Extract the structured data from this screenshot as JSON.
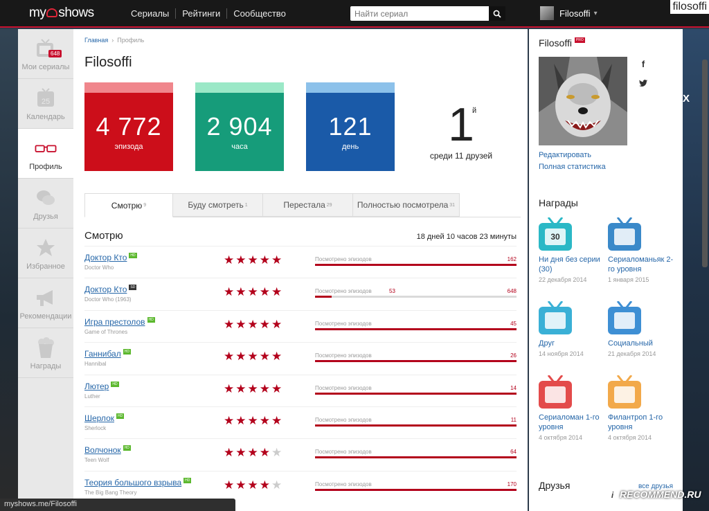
{
  "header": {
    "logo_prefix": "my",
    "logo_suffix": "shows",
    "nav": [
      "Сериалы",
      "Рейтинги",
      "Сообщество"
    ],
    "search_placeholder": "Найти сериал",
    "username": "Filosoffi",
    "watermark": "filosoffi"
  },
  "sidebar": {
    "items": [
      {
        "label": "Мои сериалы",
        "icon": "tv-icon",
        "badge": "648"
      },
      {
        "label": "Календарь",
        "icon": "calendar-icon",
        "day": "25"
      },
      {
        "label": "Профиль",
        "icon": "glasses-icon"
      },
      {
        "label": "Друзья",
        "icon": "chat-bubbles-icon"
      },
      {
        "label": "Избранное",
        "icon": "star-icon"
      },
      {
        "label": "Рекомендации",
        "icon": "megaphone-icon"
      },
      {
        "label": "Награды",
        "icon": "popcorn-icon"
      }
    ]
  },
  "breadcrumb": {
    "home": "Главная",
    "separator": "›",
    "current": "Профиль"
  },
  "profile": {
    "title": "Filosoffi",
    "stats": [
      {
        "value": "4 772",
        "label": "эпизода",
        "color": "#cc0e1a",
        "strip": "#f0868c"
      },
      {
        "value": "2 904",
        "label": "часа",
        "color": "#169c7a",
        "strip": "#9be8c7"
      },
      {
        "value": "121",
        "label": "день",
        "color": "#1a5aa8",
        "strip": "#8cc1ea"
      }
    ],
    "rank": {
      "number": "1",
      "suffix": "й",
      "caption": "среди 11 друзей"
    }
  },
  "tabs": [
    {
      "label": "Смотрю",
      "count": "9"
    },
    {
      "label": "Буду смотреть",
      "count": "1"
    },
    {
      "label": "Перестала",
      "count": "29"
    },
    {
      "label": "Полностью посмотрела",
      "count": "31"
    }
  ],
  "watching": {
    "heading": "Смотрю",
    "total_time": "18 дней 10 часов 23 минуты",
    "progress_label": "Посмотрено эпизодов",
    "hd_tag": "HD",
    "pro_tag": "PRO",
    "shows": [
      {
        "title": "Доктор Кто",
        "original": "Doctor Who",
        "rating": 5,
        "watched": "162",
        "progress": 1.0,
        "tag": "HD",
        "tag_dark": false
      },
      {
        "title": "Доктор Кто",
        "original": "Doctor Who (1963)",
        "rating": 5,
        "watched_mid": "53",
        "watched": "648",
        "progress": 0.082,
        "tag": "SD",
        "tag_dark": true
      },
      {
        "title": "Игра престолов",
        "original": "Game of Thrones",
        "rating": 5,
        "watched": "45",
        "progress": 1.0,
        "tag": "HD",
        "tag_dark": false
      },
      {
        "title": "Ганнибал",
        "original": "Hannibal",
        "rating": 5,
        "watched": "26",
        "progress": 1.0,
        "tag": "HD",
        "tag_dark": false
      },
      {
        "title": "Лютер",
        "original": "Luther",
        "rating": 5,
        "watched": "14",
        "progress": 1.0,
        "tag": "HD",
        "tag_dark": false
      },
      {
        "title": "Шерлок",
        "original": "Sherlock",
        "rating": 5,
        "watched": "11",
        "progress": 1.0,
        "tag": "HD",
        "tag_dark": false
      },
      {
        "title": "Волчонок",
        "original": "Teen Wolf",
        "rating": 4,
        "watched": "64",
        "progress": 1.0,
        "tag": "HD",
        "tag_dark": false
      },
      {
        "title": "Теория большого взрыва",
        "original": "The Big Bang Theory",
        "rating": 4,
        "watched": "170",
        "progress": 1.0,
        "tag": "HD",
        "tag_dark": false
      }
    ]
  },
  "right": {
    "name": "Filosoffi",
    "pro": "PRO",
    "edit": "Редактировать",
    "full_stats": "Полная статистика",
    "awards_heading": "Награды",
    "awards": [
      {
        "name": "Ни дня без серии (30)",
        "date": "22 декабря 2014",
        "color": "#2bb8c6",
        "icon": "calendar-30-icon",
        "mark": "30"
      },
      {
        "name": "Сериаломаньяк 2-го уровня",
        "date": "1 января 2015",
        "color": "#3a89c9",
        "icon": "maniac-face-icon",
        "mark": ""
      },
      {
        "name": "Друг",
        "date": "14 ноября 2014",
        "color": "#3ab0d6",
        "icon": "friend-card-icon",
        "mark": ""
      },
      {
        "name": "Социальный",
        "date": "21 декабря 2014",
        "color": "#3e8fd4",
        "icon": "bird-icon",
        "mark": ""
      },
      {
        "name": "Сериаломан 1-го уровня",
        "date": "4 октября 2014",
        "color": "#e34b4b",
        "icon": "stars-icon",
        "mark": ""
      },
      {
        "name": "Филантроп 1-го уровня",
        "date": "4 октября 2014",
        "color": "#f2a94a",
        "icon": "gift-icon",
        "mark": ""
      }
    ],
    "friends_heading": "Друзья",
    "all_friends": "все друзья"
  },
  "statusbar": "myshows.me/Filosoffi",
  "watermark": "RECOMMEND.RU",
  "watermark_mark": "i"
}
